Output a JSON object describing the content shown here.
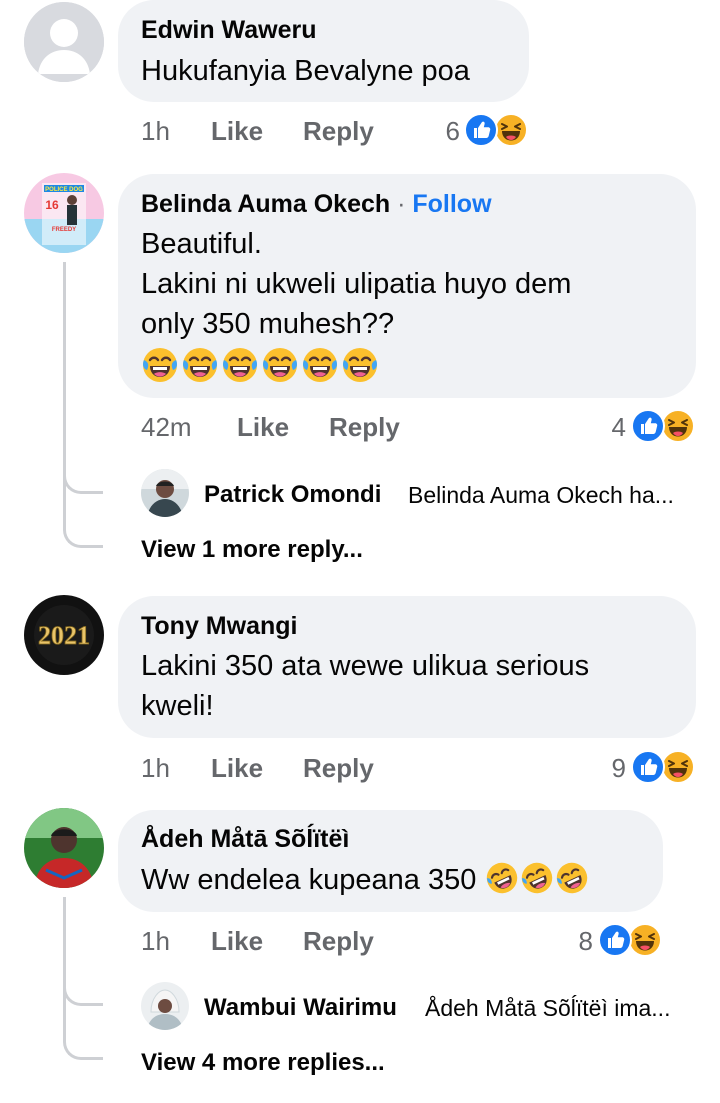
{
  "comments": [
    {
      "author": "Edwin Waweru",
      "text_lines": [
        "Hukufanyia Bevalyne poa"
      ],
      "time": "1h",
      "like_label": "Like",
      "reply_label": "Reply",
      "reaction_count": "6"
    },
    {
      "author": "Belinda Auma Okech",
      "follow_separator": " · ",
      "follow_label": "Follow",
      "text_lines": [
        "Beautiful.",
        "Lakini ni ukweli ulipatia huyo dem",
        "only 350 muhesh??"
      ],
      "emoji_count": 6,
      "time": "42m",
      "like_label": "Like",
      "reply_label": "Reply",
      "reaction_count": "4",
      "avatar_text": [
        "POLICE DOG",
        "16",
        "FREEDY"
      ],
      "reply_preview": {
        "author": "Patrick Omondi",
        "snippet": "Belinda Auma Okech ha..."
      },
      "view_more": "View 1 more reply..."
    },
    {
      "author": "Tony Mwangi",
      "text_lines": [
        "Lakini 350 ata wewe ulikua serious",
        "kweli!"
      ],
      "time": "1h",
      "like_label": "Like",
      "reply_label": "Reply",
      "reaction_count": "9",
      "avatar_text": "2021"
    },
    {
      "author": "Ådeh Måtā Sõĺïtëì",
      "text_lines": [
        "Ww endelea kupeana 350"
      ],
      "emoji_count": 3,
      "time": "1h",
      "like_label": "Like",
      "reply_label": "Reply",
      "reaction_count": "8",
      "reply_preview": {
        "author": "Wambui Wairimu",
        "snippet": "Ådeh Måtā Sõĺïtëì ima..."
      },
      "view_more": "View 4 more replies..."
    }
  ],
  "colors": {
    "bubble": "#f0f2f5",
    "muted": "#65676b",
    "link": "#1877f2",
    "like_blue": "#1877f2",
    "haha_yellow": "#f7b125",
    "thread_line": "#ced0d4"
  },
  "icons": {
    "like_reaction": "thumbs-up-icon",
    "haha_reaction": "laughing-face-icon",
    "joy_emoji": "tears-of-joy-icon",
    "rofl_emoji": "rolling-laughing-icon"
  }
}
